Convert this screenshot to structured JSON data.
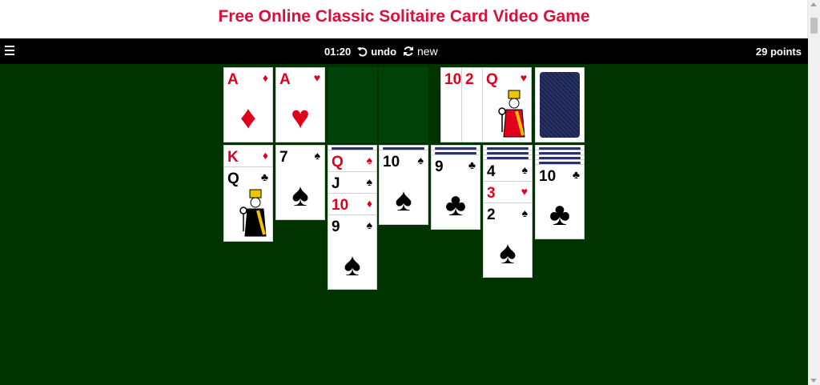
{
  "page": {
    "title": "Free Online Classic Solitaire Card Video Game"
  },
  "toolbar": {
    "time": "01:20",
    "undo_label": "undo",
    "new_label": "new",
    "points": "29 points"
  },
  "foundations": [
    {
      "rank": "A",
      "suit": "♦",
      "color": "red"
    },
    {
      "rank": "A",
      "suit": "♥",
      "color": "red"
    },
    {
      "empty": true
    },
    {
      "empty": true
    }
  ],
  "waste": [
    {
      "rank": "10",
      "suit": "♥",
      "color": "red"
    },
    {
      "rank": "2",
      "suit": "♥",
      "color": "red"
    },
    {
      "rank": "Q",
      "suit": "♥",
      "color": "red"
    }
  ],
  "stock": {
    "state": "card-back"
  },
  "tableau": [
    {
      "facedown": 0,
      "cards": [
        {
          "rank": "K",
          "suit": "♦",
          "color": "red"
        },
        {
          "rank": "Q",
          "suit": "♣",
          "color": "black"
        }
      ]
    },
    {
      "facedown": 0,
      "cards": [
        {
          "rank": "7",
          "suit": "♠",
          "color": "black"
        }
      ]
    },
    {
      "facedown": 1,
      "cards": [
        {
          "rank": "Q",
          "suit": "♠",
          "color": "red"
        },
        {
          "rank": "J",
          "suit": "♠",
          "color": "black"
        },
        {
          "rank": "10",
          "suit": "♦",
          "color": "red"
        },
        {
          "rank": "9",
          "suit": "♠",
          "color": "black"
        }
      ]
    },
    {
      "facedown": 1,
      "cards": [
        {
          "rank": "10",
          "suit": "♠",
          "color": "black"
        }
      ]
    },
    {
      "facedown": 2,
      "cards": [
        {
          "rank": "9",
          "suit": "♣",
          "color": "black"
        }
      ]
    },
    {
      "facedown": 3,
      "cards": [
        {
          "rank": "4",
          "suit": "♠",
          "color": "black"
        },
        {
          "rank": "3",
          "suit": "♥",
          "color": "red"
        },
        {
          "rank": "2",
          "suit": "♠",
          "color": "black"
        }
      ]
    },
    {
      "facedown": 4,
      "cards": [
        {
          "rank": "10",
          "suit": "♣",
          "color": "black"
        }
      ]
    }
  ]
}
